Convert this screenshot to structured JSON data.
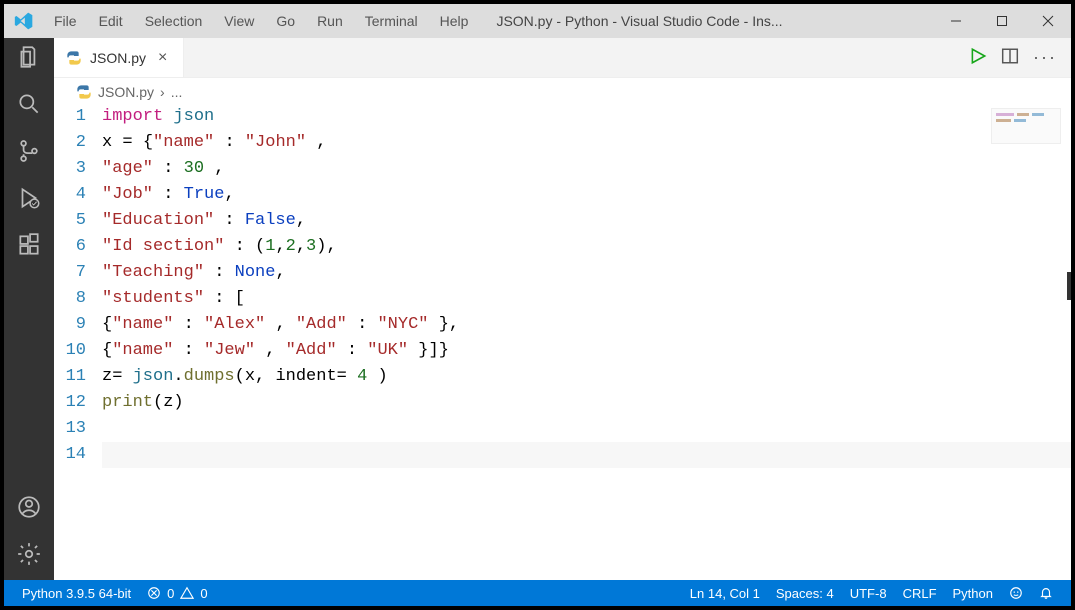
{
  "menubar": [
    "File",
    "Edit",
    "Selection",
    "View",
    "Go",
    "Run",
    "Terminal",
    "Help"
  ],
  "window_title": "JSON.py - Python - Visual Studio Code - Ins...",
  "tab": {
    "label": "JSON.py"
  },
  "breadcrumb": {
    "file": "JSON.py",
    "more": "..."
  },
  "code_lines": [
    {
      "n": 1,
      "tokens": [
        [
          "kw",
          "import"
        ],
        [
          "px",
          " "
        ],
        [
          "mod",
          "json"
        ]
      ]
    },
    {
      "n": 2,
      "tokens": [
        [
          "name",
          "x "
        ],
        [
          "op",
          "= "
        ],
        [
          "punc",
          "{"
        ],
        [
          "str",
          "\"name\""
        ],
        [
          "px",
          " "
        ],
        [
          "op",
          ":"
        ],
        [
          "px",
          " "
        ],
        [
          "str",
          "\"John\""
        ],
        [
          "px",
          " "
        ],
        [
          "punc",
          ","
        ]
      ]
    },
    {
      "n": 3,
      "tokens": [
        [
          "str",
          "\"age\""
        ],
        [
          "px",
          " "
        ],
        [
          "op",
          ":"
        ],
        [
          "px",
          " "
        ],
        [
          "num",
          "30"
        ],
        [
          "px",
          " "
        ],
        [
          "punc",
          ","
        ]
      ]
    },
    {
      "n": 4,
      "tokens": [
        [
          "str",
          "\"Job\""
        ],
        [
          "px",
          " "
        ],
        [
          "op",
          ":"
        ],
        [
          "px",
          " "
        ],
        [
          "bool",
          "True"
        ],
        [
          "punc",
          ","
        ]
      ]
    },
    {
      "n": 5,
      "tokens": [
        [
          "str",
          "\"Education\""
        ],
        [
          "px",
          " "
        ],
        [
          "op",
          ":"
        ],
        [
          "px",
          " "
        ],
        [
          "bool",
          "False"
        ],
        [
          "punc",
          ","
        ]
      ]
    },
    {
      "n": 6,
      "tokens": [
        [
          "str",
          "\"Id section\""
        ],
        [
          "px",
          " "
        ],
        [
          "op",
          ":"
        ],
        [
          "px",
          " "
        ],
        [
          "punc",
          "("
        ],
        [
          "num",
          "1"
        ],
        [
          "punc",
          ","
        ],
        [
          "num",
          "2"
        ],
        [
          "punc",
          ","
        ],
        [
          "num",
          "3"
        ],
        [
          "punc",
          "),"
        ]
      ]
    },
    {
      "n": 7,
      "tokens": [
        [
          "str",
          "\"Teaching\""
        ],
        [
          "px",
          " "
        ],
        [
          "op",
          ":"
        ],
        [
          "px",
          " "
        ],
        [
          "bool",
          "None"
        ],
        [
          "punc",
          ","
        ]
      ]
    },
    {
      "n": 8,
      "tokens": [
        [
          "str",
          "\"students\""
        ],
        [
          "px",
          " "
        ],
        [
          "op",
          ":"
        ],
        [
          "px",
          " "
        ],
        [
          "punc",
          "["
        ]
      ]
    },
    {
      "n": 9,
      "tokens": [
        [
          "punc",
          "{"
        ],
        [
          "str",
          "\"name\""
        ],
        [
          "px",
          " "
        ],
        [
          "op",
          ":"
        ],
        [
          "px",
          " "
        ],
        [
          "str",
          "\"Alex\""
        ],
        [
          "px",
          " "
        ],
        [
          "punc",
          ","
        ],
        [
          "px",
          " "
        ],
        [
          "str",
          "\"Add\""
        ],
        [
          "px",
          " "
        ],
        [
          "op",
          ":"
        ],
        [
          "px",
          " "
        ],
        [
          "str",
          "\"NYC\""
        ],
        [
          "px",
          " "
        ],
        [
          "punc",
          "},"
        ]
      ]
    },
    {
      "n": 10,
      "tokens": [
        [
          "punc",
          "{"
        ],
        [
          "str",
          "\"name\""
        ],
        [
          "px",
          " "
        ],
        [
          "op",
          ":"
        ],
        [
          "px",
          " "
        ],
        [
          "str",
          "\"Jew\""
        ],
        [
          "px",
          " "
        ],
        [
          "punc",
          ","
        ],
        [
          "px",
          " "
        ],
        [
          "str",
          "\"Add\""
        ],
        [
          "px",
          " "
        ],
        [
          "op",
          ":"
        ],
        [
          "px",
          " "
        ],
        [
          "str",
          "\"UK\""
        ],
        [
          "px",
          " "
        ],
        [
          "punc",
          "}]}"
        ]
      ]
    },
    {
      "n": 11,
      "tokens": [
        [
          "name",
          "z"
        ],
        [
          "op",
          "= "
        ],
        [
          "mod",
          "json"
        ],
        [
          "punc",
          "."
        ],
        [
          "fn",
          "dumps"
        ],
        [
          "punc",
          "("
        ],
        [
          "name",
          "x"
        ],
        [
          "punc",
          ", "
        ],
        [
          "name",
          "indent"
        ],
        [
          "op",
          "= "
        ],
        [
          "num",
          "4"
        ],
        [
          "px",
          " "
        ],
        [
          "punc",
          ")"
        ]
      ]
    },
    {
      "n": 12,
      "tokens": [
        [
          "fn",
          "print"
        ],
        [
          "punc",
          "("
        ],
        [
          "name",
          "z"
        ],
        [
          "punc",
          ")"
        ]
      ]
    },
    {
      "n": 13,
      "tokens": []
    },
    {
      "n": 14,
      "tokens": [],
      "current": true
    }
  ],
  "status": {
    "python_version": "Python 3.9.5 64-bit",
    "errors": "0",
    "warnings": "0",
    "cursor": "Ln 14, Col 1",
    "spaces": "Spaces: 4",
    "encoding": "UTF-8",
    "eol": "CRLF",
    "lang": "Python"
  }
}
